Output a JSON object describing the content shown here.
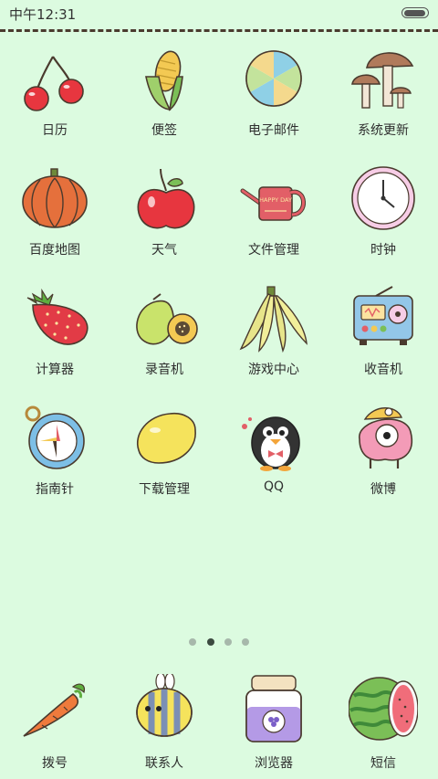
{
  "status_bar": {
    "time": "中午12:31"
  },
  "apps": [
    {
      "label": "日历",
      "icon": "cherry-icon"
    },
    {
      "label": "便签",
      "icon": "corn-icon"
    },
    {
      "label": "电子邮件",
      "icon": "candy-icon"
    },
    {
      "label": "系统更新",
      "icon": "mushroom-icon"
    },
    {
      "label": "百度地图",
      "icon": "pumpkin-icon"
    },
    {
      "label": "天气",
      "icon": "apple-icon"
    },
    {
      "label": "文件管理",
      "icon": "watering-can-icon"
    },
    {
      "label": "时钟",
      "icon": "clock-icon"
    },
    {
      "label": "计算器",
      "icon": "strawberry-icon"
    },
    {
      "label": "录音机",
      "icon": "papaya-icon"
    },
    {
      "label": "游戏中心",
      "icon": "banana-icon"
    },
    {
      "label": "收音机",
      "icon": "radio-icon"
    },
    {
      "label": "指南针",
      "icon": "compass-icon"
    },
    {
      "label": "下载管理",
      "icon": "lemon-icon"
    },
    {
      "label": "QQ",
      "icon": "penguin-icon"
    },
    {
      "label": "微博",
      "icon": "blob-icon"
    }
  ],
  "watering_can_text": "HAPPY DAY",
  "page_indicator": {
    "count": 4,
    "active_index": 1
  },
  "dock": [
    {
      "label": "拨号",
      "icon": "carrot-icon"
    },
    {
      "label": "联系人",
      "icon": "bee-icon"
    },
    {
      "label": "浏览器",
      "icon": "jam-jar-icon"
    },
    {
      "label": "短信",
      "icon": "watermelon-icon"
    }
  ],
  "colors": {
    "background": "#dcfbe0",
    "label_text": "#2e2e2e"
  }
}
